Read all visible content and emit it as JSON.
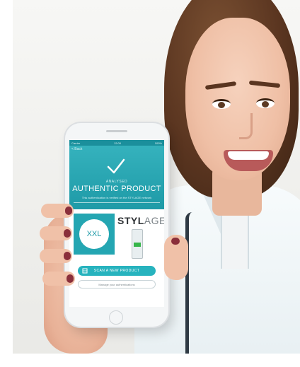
{
  "phone_screen": {
    "status_left": "Carrier",
    "status_center": "12:00",
    "status_right": "100%",
    "back_label": "< Back",
    "small_caption": "ANALYSED",
    "headline": "AUTHENTIC PRODUCT",
    "note": "This authentication is verified on the STYLAGE network",
    "badge_text": "XXL",
    "brand_main": "STYL",
    "brand_tail": "AGE",
    "scan_button": "SCAN A NEW PRODUCT",
    "secondary_button": "Manage your authentications"
  },
  "colors": {
    "accent": "#27b3be",
    "accent_dark": "#1e9aa7",
    "nail_polish": "#8a2f3b"
  },
  "icons": [
    "check-icon",
    "scan-icon"
  ]
}
